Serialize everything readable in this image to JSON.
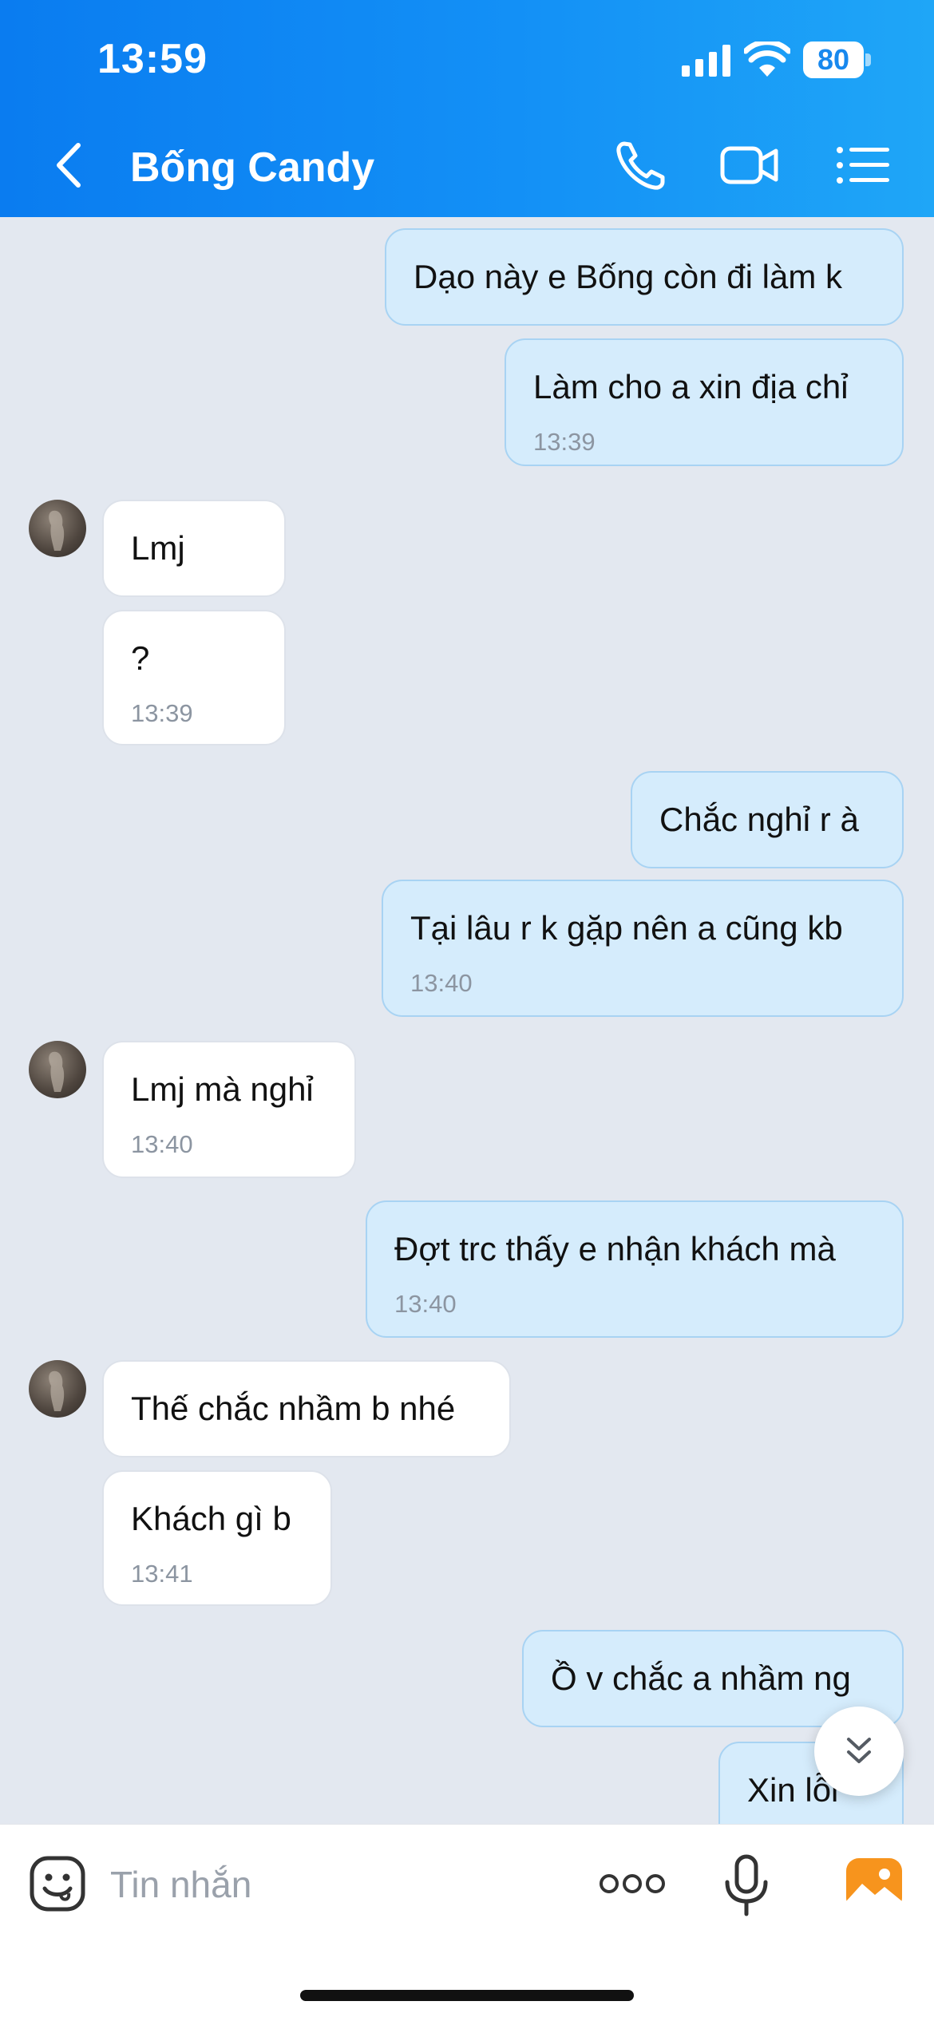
{
  "status_bar": {
    "time": "13:59",
    "battery": "80"
  },
  "header": {
    "title": "Bống Candy"
  },
  "messages": [
    {
      "dir": "out",
      "text": "Dạo này e Bống còn đi làm k",
      "time": ""
    },
    {
      "dir": "out",
      "text": "Làm cho a xin địa chỉ",
      "time": "13:39"
    },
    {
      "dir": "in",
      "text": "Lmj",
      "time": ""
    },
    {
      "dir": "in",
      "text": "?",
      "time": "13:39"
    },
    {
      "dir": "out",
      "text": "Chắc nghỉ r à",
      "time": ""
    },
    {
      "dir": "out",
      "text": "Tại lâu r k gặp nên a cũng kb",
      "time": "13:40"
    },
    {
      "dir": "in",
      "text": "Lmj mà nghỉ",
      "time": "13:40"
    },
    {
      "dir": "out",
      "text": "Đợt trc thấy e nhận khách mà",
      "time": "13:40"
    },
    {
      "dir": "in",
      "text": "Thế chắc nhầm b nhé",
      "time": ""
    },
    {
      "dir": "in",
      "text": "Khách gì b",
      "time": "13:41"
    },
    {
      "dir": "out",
      "text": "Ồ v chắc a nhầm ng",
      "time": ""
    },
    {
      "dir": "out",
      "text": "Xin lỗi",
      "time": ""
    }
  ],
  "composer": {
    "placeholder": "Tin nhắn"
  },
  "icons": {
    "back": "chevron-left-icon",
    "call": "phone-icon",
    "video": "video-camera-icon",
    "menu": "list-icon",
    "emoji": "sticker-icon",
    "more": "more-dots-icon",
    "mic": "microphone-icon",
    "photo": "photo-icon",
    "scroll": "double-chevron-down-icon"
  },
  "colors": {
    "header": "#0a7cf0",
    "outgoing_bubble": "#d5ecfc",
    "incoming_bubble": "#ffffff",
    "chat_background": "#e3e8f0"
  }
}
